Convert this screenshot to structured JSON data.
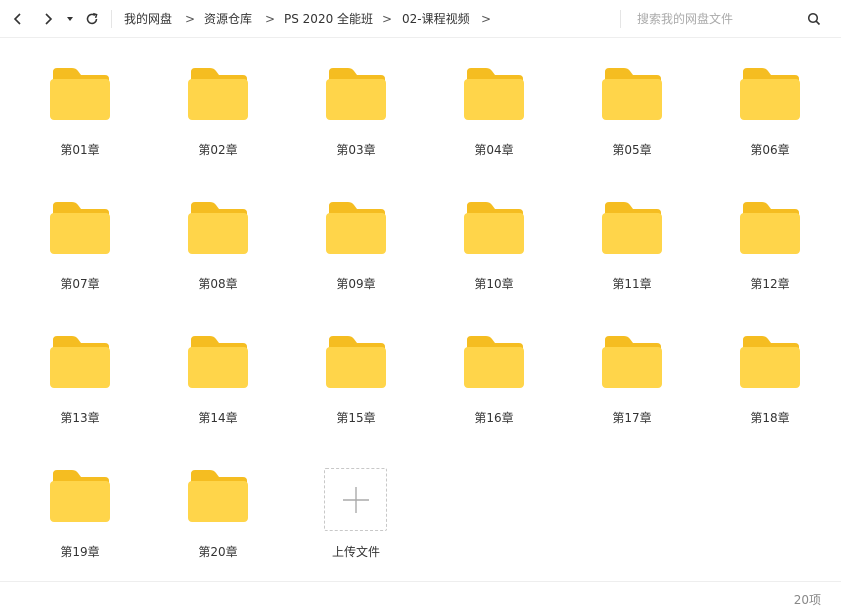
{
  "colors": {
    "folder_front": "#FFD54A",
    "folder_back": "#F5BD21",
    "divider": "#EEEEEE"
  },
  "toolbar": {
    "back_icon": "chevron-left-icon",
    "forward_icon": "chevron-right-icon",
    "history_icon": "caret-down-icon",
    "refresh_icon": "refresh-icon",
    "search_icon": "magnifier-icon",
    "separator": ">",
    "breadcrumb": [
      "我的网盘",
      "资源仓库",
      "PS 2020 全能班",
      "02-课程视频"
    ],
    "search_placeholder": "搜索我的网盘文件"
  },
  "folders": [
    "第01章",
    "第02章",
    "第03章",
    "第04章",
    "第05章",
    "第06章",
    "第07章",
    "第08章",
    "第09章",
    "第10章",
    "第11章",
    "第12章",
    "第13章",
    "第14章",
    "第15章",
    "第16章",
    "第17章",
    "第18章",
    "第19章",
    "第20章"
  ],
  "upload": {
    "label": "上传文件",
    "icon": "plus-icon"
  },
  "footer": {
    "count": "20项"
  }
}
